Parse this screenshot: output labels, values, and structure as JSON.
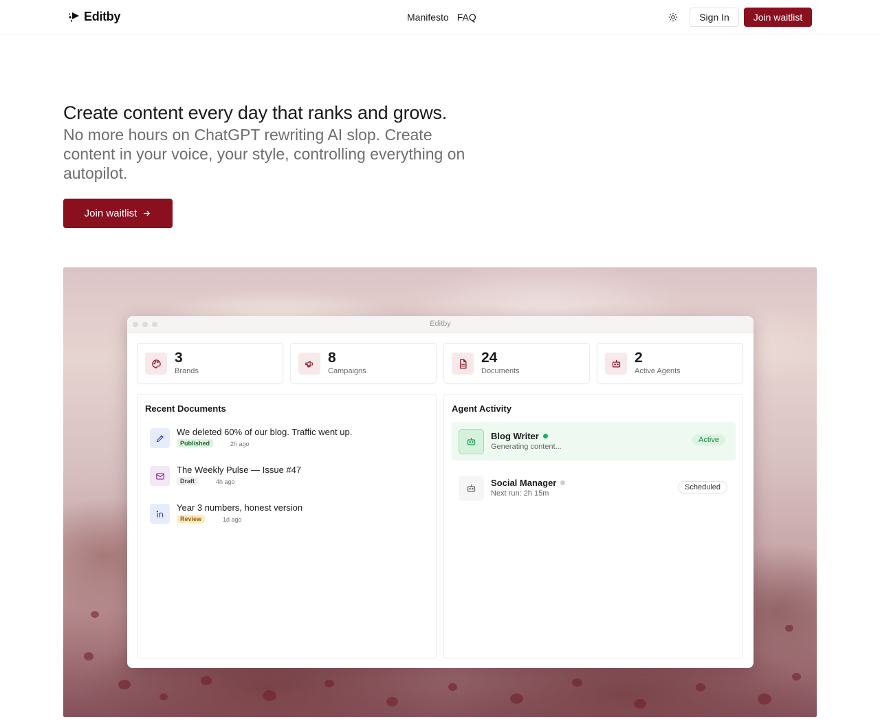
{
  "nav": {
    "brand": "Editby",
    "links": [
      "Manifesto",
      "FAQ"
    ],
    "theme_icon": "sun-icon",
    "signin_label": "Sign In",
    "waitlist_label": "Join waitlist"
  },
  "hero": {
    "title": "Create content every day that ranks and grows.",
    "subtitle": "No more hours on ChatGPT rewriting AI slop. Create content in your voice, your style, controlling everything on autopilot.",
    "cta_label": "Join waitlist",
    "cta_icon": "arrow-right-icon"
  },
  "app": {
    "window_title": "Editby",
    "stats": [
      {
        "value": "3",
        "label": "Brands",
        "icon": "palette-icon"
      },
      {
        "value": "8",
        "label": "Campaigns",
        "icon": "megaphone-icon"
      },
      {
        "value": "24",
        "label": "Documents",
        "icon": "document-icon"
      },
      {
        "value": "2",
        "label": "Active Agents",
        "icon": "bot-icon"
      }
    ],
    "recent_documents": {
      "title": "Recent Documents",
      "items": [
        {
          "title": "We deleted 60% of our blog. Traffic went up.",
          "status": "Published",
          "time": "2h ago",
          "icon": "pen-icon"
        },
        {
          "title": "The Weekly Pulse — Issue #47",
          "status": "Draft",
          "time": "4h ago",
          "icon": "mail-icon"
        },
        {
          "title": "Year 3 numbers, honest version",
          "status": "Review",
          "time": "1d ago",
          "icon": "linkedin-icon"
        }
      ]
    },
    "agent_activity": {
      "title": "Agent Activity",
      "items": [
        {
          "name": "Blog Writer",
          "detail": "Generating content...",
          "status": "Active"
        },
        {
          "name": "Social Manager",
          "detail": "Next run: 2h 15m",
          "status": "Scheduled"
        }
      ]
    }
  },
  "colors": {
    "brand": "#8a0f1f",
    "published_bg": "#dff2e1",
    "draft_bg": "#efefef",
    "review_bg": "#fdebc6",
    "active_green": "#22b35a"
  }
}
